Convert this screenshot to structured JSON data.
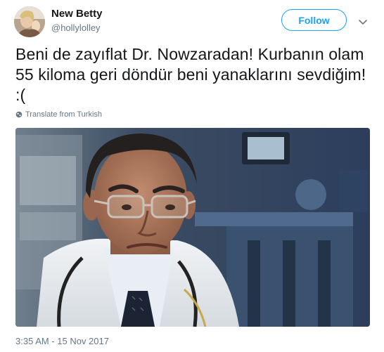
{
  "user": {
    "display_name": "New Betty",
    "handle": "@hollylolley",
    "avatar_icon": "profile-photo"
  },
  "follow_button": {
    "label": "Follow"
  },
  "menu": {
    "icon": "chevron-down-icon"
  },
  "tweet": {
    "text": "Beni de zayıflat Dr. Nowzaradan! Kurbanın olam 55 kiloma geri döndür beni yanaklarını sevdiğim! :(",
    "translate_label": "Translate from Turkish",
    "timestamp": "3:35 AM - 15 Nov 2017"
  },
  "colors": {
    "accent": "#1da1f2",
    "text_primary": "#14171a",
    "text_secondary": "#657786"
  }
}
